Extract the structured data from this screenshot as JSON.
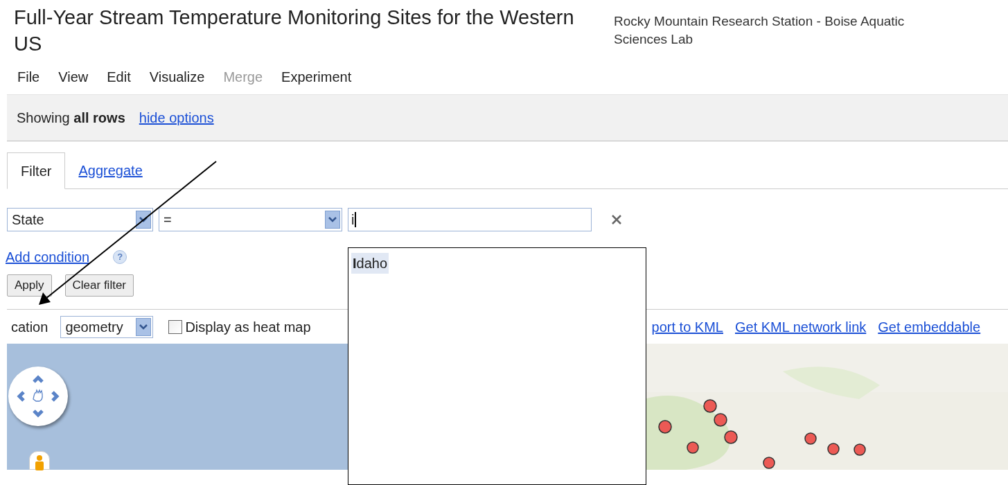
{
  "header": {
    "title": "Full-Year Stream Temperature Monitoring Sites for the Western US",
    "owner": "Rocky Mountain Research Station - Boise Aquatic Sciences Lab"
  },
  "menu": [
    {
      "label": "File",
      "disabled": false
    },
    {
      "label": "View",
      "disabled": false
    },
    {
      "label": "Edit",
      "disabled": false
    },
    {
      "label": "Visualize",
      "disabled": false
    },
    {
      "label": "Merge",
      "disabled": true
    },
    {
      "label": "Experiment",
      "disabled": false
    }
  ],
  "options_bar": {
    "status": "Showing **all rows**",
    "link": "hide options"
  },
  "tabs": [
    {
      "label": "Filter",
      "selected": true
    },
    {
      "label": "Aggregate",
      "selected": false
    }
  ],
  "filter": {
    "column": "State",
    "operator": "=",
    "value": "i",
    "add_condition": "Add condition",
    "help": "?",
    "buttons": [
      "Apply",
      "Clear filter"
    ]
  },
  "suggestions": [
    {
      "text": "**I**daho",
      "selected": true
    }
  ],
  "location": {
    "label": "cation",
    "column": "geometry",
    "heat_map": {
      "label": "Display as heat map",
      "checked": false
    },
    "links": [
      "port to KML",
      "Get KML network link",
      "Get embeddable"
    ]
  }
}
